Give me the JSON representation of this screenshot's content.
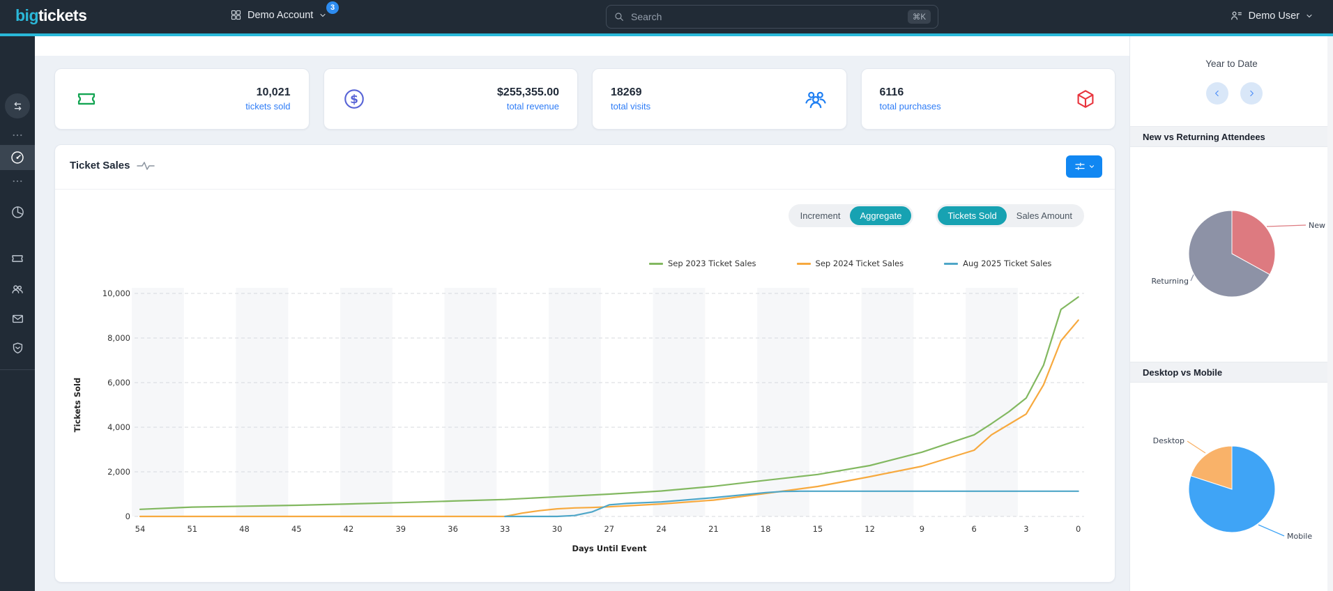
{
  "navbar": {
    "logo_part1": "big",
    "logo_part2": "tickets",
    "account_label": "Demo Account",
    "account_badge": "3",
    "search_placeholder": "Search",
    "search_shortcut": "⌘K",
    "user_label": "Demo User"
  },
  "sidebar": {
    "items": [
      {
        "icon": "collapse-toggle",
        "active": false
      },
      {
        "icon": "ellipsis",
        "active": false
      },
      {
        "icon": "dashboard-gauge",
        "active": true
      },
      {
        "icon": "ellipsis",
        "active": false
      },
      {
        "icon": "pie-chart",
        "active": false
      },
      {
        "icon": "ticket",
        "active": false
      },
      {
        "icon": "attendees",
        "active": false
      },
      {
        "icon": "mail",
        "active": false
      },
      {
        "icon": "shield",
        "active": false
      }
    ]
  },
  "stats": [
    {
      "value": "10,021",
      "label": "tickets sold",
      "icon": "ticket-icon",
      "accent": "#13a452"
    },
    {
      "value": "$255,355.00",
      "label": "total revenue",
      "icon": "dollar-circle-icon",
      "accent": "#5864d6"
    },
    {
      "value": "18269",
      "label": "total visits",
      "icon": "attendees-icon",
      "accent": "#1f7ff2"
    },
    {
      "value": "6116",
      "label": "total purchases",
      "icon": "package-icon",
      "accent": "#e8343d"
    }
  ],
  "chart_panel": {
    "title": "Ticket Sales",
    "toggle_groups": [
      {
        "options": [
          {
            "label": "Increment",
            "active": false
          },
          {
            "label": "Aggregate",
            "active": true
          }
        ]
      },
      {
        "options": [
          {
            "label": "Tickets Sold",
            "active": true
          },
          {
            "label": "Sales Amount",
            "active": false
          }
        ]
      }
    ]
  },
  "right_panel": {
    "period_label": "Year to Date",
    "sections": [
      {
        "title": "New vs Returning Attendees"
      },
      {
        "title": "Desktop vs Mobile"
      }
    ]
  },
  "chart_data": [
    {
      "type": "line",
      "title": "Ticket Sales",
      "xlabel": "Days Until Event",
      "ylabel": "Tickets Sold",
      "x_ticks": [
        54,
        51,
        48,
        45,
        42,
        39,
        36,
        33,
        30,
        27,
        24,
        21,
        18,
        15,
        12,
        9,
        6,
        3,
        0
      ],
      "x_reversed": true,
      "ylim": [
        0,
        10000
      ],
      "y_ticks": [
        0,
        2000,
        4000,
        6000,
        8000,
        10000
      ],
      "grid": "horizontal-dashed",
      "background_bands": "alternating-3-day-vertical-stripes",
      "legend_position": "top-right",
      "series": [
        {
          "name": "Sep 2023 Ticket Sales",
          "color": "#82b860",
          "points": [
            [
              54,
              320
            ],
            [
              51,
              420
            ],
            [
              48,
              460
            ],
            [
              45,
              500
            ],
            [
              42,
              560
            ],
            [
              39,
              620
            ],
            [
              36,
              690
            ],
            [
              33,
              760
            ],
            [
              30,
              880
            ],
            [
              27,
              1000
            ],
            [
              24,
              1140
            ],
            [
              21,
              1350
            ],
            [
              18,
              1620
            ],
            [
              15,
              1880
            ],
            [
              12,
              2280
            ],
            [
              9,
              2880
            ],
            [
              6,
              3660
            ],
            [
              5,
              4160
            ],
            [
              4,
              4690
            ],
            [
              3,
              5310
            ],
            [
              2,
              6780
            ],
            [
              1,
              9280
            ],
            [
              0,
              9840
            ]
          ]
        },
        {
          "name": "Sep 2024 Ticket Sales",
          "color": "#f7a93e",
          "points": [
            [
              54,
              0
            ],
            [
              51,
              0
            ],
            [
              48,
              0
            ],
            [
              45,
              0
            ],
            [
              42,
              0
            ],
            [
              39,
              0
            ],
            [
              36,
              0
            ],
            [
              33,
              0
            ],
            [
              32,
              150
            ],
            [
              31,
              260
            ],
            [
              30,
              340
            ],
            [
              29,
              380
            ],
            [
              28,
              400
            ],
            [
              27,
              430
            ],
            [
              24,
              560
            ],
            [
              21,
              730
            ],
            [
              18,
              1030
            ],
            [
              15,
              1345
            ],
            [
              12,
              1780
            ],
            [
              9,
              2250
            ],
            [
              6,
              2970
            ],
            [
              5,
              3660
            ],
            [
              4,
              4125
            ],
            [
              3,
              4590
            ],
            [
              2,
              5900
            ],
            [
              1,
              7875
            ],
            [
              0,
              8800
            ]
          ]
        },
        {
          "name": "Aug 2025 Ticket Sales",
          "color": "#4ea6c8",
          "points": [
            [
              33,
              0
            ],
            [
              30,
              0
            ],
            [
              29,
              40
            ],
            [
              28,
              200
            ],
            [
              27,
              520
            ],
            [
              26,
              580
            ],
            [
              24,
              650
            ],
            [
              21,
              840
            ],
            [
              18,
              1070
            ],
            [
              17,
              1120
            ],
            [
              16,
              1130
            ],
            [
              15,
              1130
            ],
            [
              12,
              1130
            ],
            [
              9,
              1130
            ],
            [
              6,
              1130
            ],
            [
              3,
              1130
            ],
            [
              0,
              1130
            ]
          ]
        }
      ]
    },
    {
      "type": "pie",
      "title": "New vs Returning Attendees",
      "unit": "percent",
      "start_angle": 0,
      "slices": [
        {
          "label": "New",
          "value": 33,
          "color": "#dd7a80"
        },
        {
          "label": "Returning",
          "value": 67,
          "color": "#8d92a6"
        }
      ]
    },
    {
      "type": "pie",
      "title": "Desktop vs Mobile",
      "unit": "percent",
      "start_angle": -72,
      "slices": [
        {
          "label": "Desktop",
          "value": 20,
          "color": "#f9b269"
        },
        {
          "label": "Mobile",
          "value": 80,
          "color": "#3fa4f6"
        }
      ]
    }
  ]
}
